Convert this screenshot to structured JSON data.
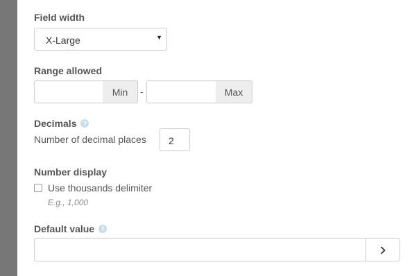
{
  "field_width": {
    "label": "Field width",
    "selected": "X-Large"
  },
  "range": {
    "label": "Range allowed",
    "min_value": "",
    "min_addon": "Min",
    "separator": "-",
    "max_value": "",
    "max_addon": "Max"
  },
  "decimals": {
    "label": "Decimals",
    "help_icon": "question-circle-icon",
    "places_label": "Number of decimal places",
    "places_value": "2"
  },
  "number_display": {
    "label": "Number display",
    "checkbox_label": "Use thousands delimiter",
    "checked": false,
    "hint": "E.g., 1,000"
  },
  "default_value": {
    "label": "Default value",
    "help_icon": "question-circle-icon",
    "value": "",
    "button_icon": "chevron-right-icon"
  }
}
